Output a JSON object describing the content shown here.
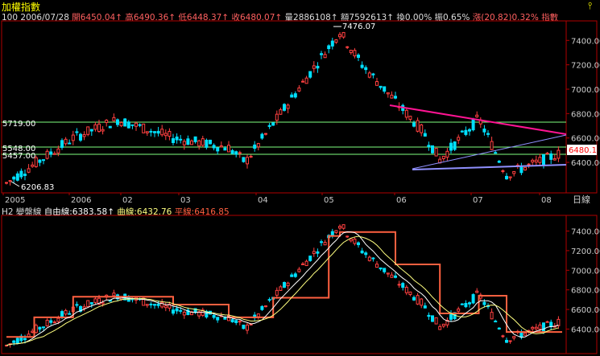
{
  "header": {
    "title": "加權指數",
    "pin_icon": "pin-icon"
  },
  "stats": {
    "code": "100",
    "date": "2006/07/28",
    "open": "開6450.04↑",
    "high": "高6490.36↑",
    "low": "低6448.37↑",
    "close": "收6480.07↑",
    "volume": "量2886108↑",
    "amount": "額7592613↑",
    "turnover": "換0.00%",
    "amplitude": "振0.65%",
    "change": "漲(20.82)0.32%",
    "index_label": "指數"
  },
  "price_panel": {
    "y_ticks": [
      "7400.00",
      "7200.00",
      "7000.00",
      "6800.00",
      "6600.00",
      "6400.00"
    ],
    "y_tick_values": [
      7400,
      7200,
      7000,
      6800,
      6600,
      6400
    ],
    "h_lines": [
      {
        "label": "5719.00",
        "value": 5719
      },
      {
        "label": "5548.00",
        "value": 5548
      },
      {
        "label": "5457.00",
        "value": 5457
      }
    ],
    "high_marker": "7476.07",
    "low_marker": "6206.83",
    "last_price": "6480.1",
    "ymin": 6150,
    "ymax": 7560
  },
  "x_axis": {
    "labels": [
      "2005",
      "2006",
      "02",
      "03",
      "04",
      "05",
      "06",
      "07",
      "08"
    ],
    "unit": "日線"
  },
  "indicator_panel": {
    "prefix": "H2",
    "name": "變盤線",
    "free_line": "自由線:6383.58↑",
    "curve_line": "曲線:6432.76",
    "flat_line": "平線:6416.85",
    "y_ticks": [
      "7400.00",
      "7200.00",
      "7000.00",
      "6800.00",
      "6600.00",
      "6400.00"
    ],
    "y_tick_values": [
      7400,
      7200,
      7000,
      6800,
      6600,
      6400
    ]
  },
  "colors": {
    "up": "#ff4040",
    "down": "#00e0ff",
    "grid": "#7a0000",
    "hline": "#80ff80",
    "trend_pink": "#ff1493",
    "trend_purple": "#9090ff",
    "step": "#ff6040",
    "curve": "#ffff80",
    "axis_text": "#cccccc"
  }
}
